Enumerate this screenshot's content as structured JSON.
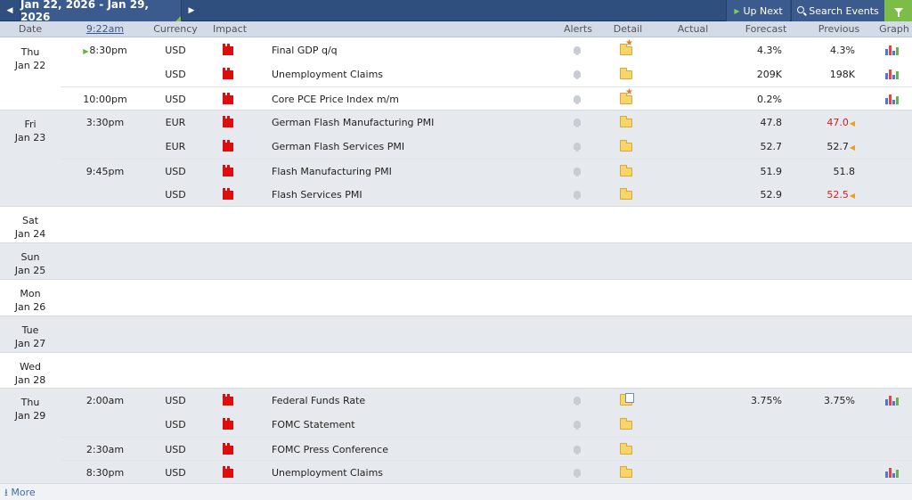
{
  "toolbar": {
    "date_range": "Jan 22, 2026 - Jan 29, 2026",
    "up_next": "Up Next",
    "search_events": "Search Events"
  },
  "header": {
    "date": "Date",
    "time": "9:22am",
    "currency": "Currency",
    "impact": "Impact",
    "alerts": "Alerts",
    "detail": "Detail",
    "actual": "Actual",
    "forecast": "Forecast",
    "previous": "Previous",
    "graph": "Graph"
  },
  "days": [
    {
      "weekday": "Thu",
      "date": "Jan 22"
    },
    {
      "weekday": "Fri",
      "date": "Jan 23"
    },
    {
      "weekday": "Sat",
      "date": "Jan 24"
    },
    {
      "weekday": "Sun",
      "date": "Jan 25"
    },
    {
      "weekday": "Mon",
      "date": "Jan 26"
    },
    {
      "weekday": "Tue",
      "date": "Jan 27"
    },
    {
      "weekday": "Wed",
      "date": "Jan 28"
    },
    {
      "weekday": "Thu",
      "date": "Jan 29"
    }
  ],
  "events": [
    {
      "time": "8:30pm",
      "currency": "USD",
      "event": "Final GDP q/q",
      "actual": "",
      "forecast": "4.3%",
      "previous": "4.3%",
      "detail_icon": "folder-star-icon",
      "has_graph": true,
      "upcoming": true
    },
    {
      "time": "",
      "currency": "USD",
      "event": "Unemployment Claims",
      "actual": "",
      "forecast": "209K",
      "previous": "198K",
      "detail_icon": "folder-icon",
      "has_graph": true
    },
    {
      "time": "10:00pm",
      "currency": "USD",
      "event": "Core PCE Price Index m/m",
      "actual": "",
      "forecast": "0.2%",
      "previous": "",
      "detail_icon": "folder-star-icon",
      "has_graph": true
    },
    {
      "time": "3:30pm",
      "currency": "EUR",
      "event": "German Flash Manufacturing PMI",
      "actual": "",
      "forecast": "47.8",
      "previous": "47.0",
      "previous_revised": true,
      "detail_icon": "folder-icon",
      "has_graph": false
    },
    {
      "time": "",
      "currency": "EUR",
      "event": "German Flash Services PMI",
      "actual": "",
      "forecast": "52.7",
      "previous": "52.7",
      "previous_revised_up": true,
      "detail_icon": "folder-icon",
      "has_graph": false
    },
    {
      "time": "9:45pm",
      "currency": "USD",
      "event": "Flash Manufacturing PMI",
      "actual": "",
      "forecast": "51.9",
      "previous": "51.8",
      "detail_icon": "folder-icon",
      "has_graph": false
    },
    {
      "time": "",
      "currency": "USD",
      "event": "Flash Services PMI",
      "actual": "",
      "forecast": "52.9",
      "previous": "52.5",
      "previous_revised": true,
      "detail_icon": "folder-icon",
      "has_graph": false
    },
    {
      "time": "2:00am",
      "currency": "USD",
      "event": "Federal Funds Rate",
      "actual": "",
      "forecast": "3.75%",
      "previous": "3.75%",
      "detail_icon": "folder-doc-icon",
      "has_graph": true
    },
    {
      "time": "",
      "currency": "USD",
      "event": "FOMC Statement",
      "actual": "",
      "forecast": "",
      "previous": "",
      "detail_icon": "folder-icon",
      "has_graph": false
    },
    {
      "time": "2:30am",
      "currency": "USD",
      "event": "FOMC Press Conference",
      "actual": "",
      "forecast": "",
      "previous": "",
      "detail_icon": "folder-icon",
      "has_graph": false
    },
    {
      "time": "8:30pm",
      "currency": "USD",
      "event": "Unemployment Claims",
      "actual": "",
      "forecast": "",
      "previous": "",
      "detail_icon": "folder-icon",
      "has_graph": true
    }
  ],
  "footer": {
    "more": "More"
  },
  "colors": {
    "topbar": "#2f4f7f",
    "high_impact": "#e00d0d",
    "revised_down": "#d32020",
    "accent_green": "#7cbd47"
  }
}
